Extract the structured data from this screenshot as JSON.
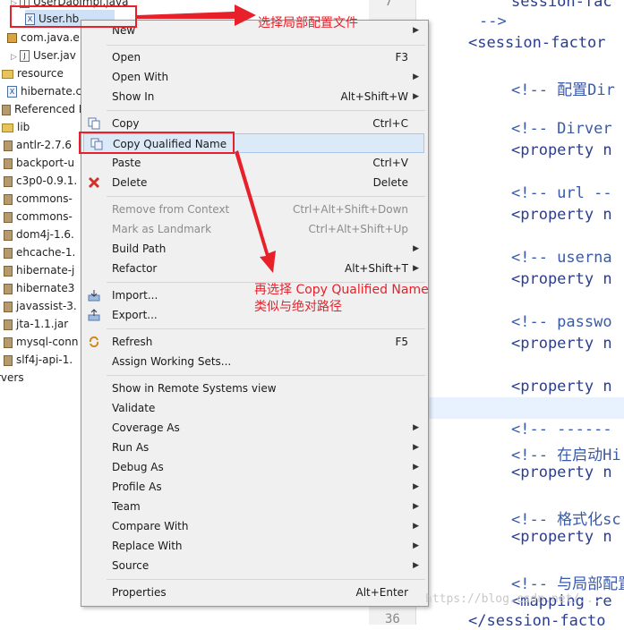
{
  "tree": {
    "items": [
      {
        "label": "UserDaoImpl.java",
        "icon": "java-file-icon"
      },
      {
        "label": "User.hb",
        "icon": "xml-file-icon"
      },
      {
        "label": "com.java.e",
        "icon": "package-icon"
      },
      {
        "label": "User.jav",
        "icon": "java-file-icon"
      },
      {
        "label": "resource",
        "icon": "folder-icon"
      },
      {
        "label": "hibernate.c",
        "icon": "xml-file-icon"
      },
      {
        "label": "Referenced Lil",
        "icon": "library-icon"
      },
      {
        "label": "lib",
        "icon": "folder-icon"
      },
      {
        "label": "antlr-2.7.6",
        "icon": "jar-icon"
      },
      {
        "label": "backport-u",
        "icon": "jar-icon"
      },
      {
        "label": "c3p0-0.9.1.",
        "icon": "jar-icon"
      },
      {
        "label": "commons-",
        "icon": "jar-icon"
      },
      {
        "label": "commons-",
        "icon": "jar-icon"
      },
      {
        "label": "dom4j-1.6.",
        "icon": "jar-icon"
      },
      {
        "label": "ehcache-1.",
        "icon": "jar-icon"
      },
      {
        "label": "hibernate-j",
        "icon": "jar-icon"
      },
      {
        "label": "hibernate3",
        "icon": "jar-icon"
      },
      {
        "label": "javassist-3.",
        "icon": "jar-icon"
      },
      {
        "label": "jta-1.1.jar",
        "icon": "jar-icon"
      },
      {
        "label": "mysql-conn",
        "icon": "jar-icon"
      },
      {
        "label": "slf4j-api-1.",
        "icon": "jar-icon"
      },
      {
        "label": "rvers",
        "icon": "folder-icon"
      }
    ]
  },
  "menu": {
    "items": [
      {
        "label": "New",
        "shortcut": "",
        "submenu": true,
        "disabled": false
      },
      {
        "label": "Open",
        "shortcut": "F3",
        "submenu": false,
        "disabled": false
      },
      {
        "label": "Open With",
        "shortcut": "",
        "submenu": true,
        "disabled": false
      },
      {
        "label": "Show In",
        "shortcut": "Alt+Shift+W",
        "submenu": true,
        "disabled": false
      },
      {
        "label": "Copy",
        "shortcut": "Ctrl+C",
        "submenu": false,
        "disabled": false
      },
      {
        "label": "Copy Qualified Name",
        "shortcut": "",
        "submenu": false,
        "disabled": false,
        "highlighted": true
      },
      {
        "label": "Paste",
        "shortcut": "Ctrl+V",
        "submenu": false,
        "disabled": false
      },
      {
        "label": "Delete",
        "shortcut": "Delete",
        "submenu": false,
        "disabled": false
      },
      {
        "label": "Remove from Context",
        "shortcut": "Ctrl+Alt+Shift+Down",
        "submenu": false,
        "disabled": true
      },
      {
        "label": "Mark as Landmark",
        "shortcut": "Ctrl+Alt+Shift+Up",
        "submenu": false,
        "disabled": true
      },
      {
        "label": "Build Path",
        "shortcut": "",
        "submenu": true,
        "disabled": false
      },
      {
        "label": "Refactor",
        "shortcut": "Alt+Shift+T",
        "submenu": true,
        "disabled": false
      },
      {
        "label": "Import...",
        "shortcut": "",
        "submenu": false,
        "disabled": false
      },
      {
        "label": "Export...",
        "shortcut": "",
        "submenu": false,
        "disabled": false
      },
      {
        "label": "Refresh",
        "shortcut": "F5",
        "submenu": false,
        "disabled": false
      },
      {
        "label": "Assign Working Sets...",
        "shortcut": "",
        "submenu": false,
        "disabled": false
      },
      {
        "label": "Show in Remote Systems view",
        "shortcut": "",
        "submenu": false,
        "disabled": false
      },
      {
        "label": "Validate",
        "shortcut": "",
        "submenu": false,
        "disabled": false
      },
      {
        "label": "Coverage As",
        "shortcut": "",
        "submenu": true,
        "disabled": false
      },
      {
        "label": "Run As",
        "shortcut": "",
        "submenu": true,
        "disabled": false
      },
      {
        "label": "Debug As",
        "shortcut": "",
        "submenu": true,
        "disabled": false
      },
      {
        "label": "Profile As",
        "shortcut": "",
        "submenu": true,
        "disabled": false
      },
      {
        "label": "Team",
        "shortcut": "",
        "submenu": true,
        "disabled": false
      },
      {
        "label": "Compare With",
        "shortcut": "",
        "submenu": true,
        "disabled": false
      },
      {
        "label": "Replace With",
        "shortcut": "",
        "submenu": true,
        "disabled": false
      },
      {
        "label": "Source",
        "shortcut": "",
        "submenu": true,
        "disabled": false
      },
      {
        "label": "Properties",
        "shortcut": "Alt+Enter",
        "submenu": false,
        "disabled": false
      }
    ]
  },
  "editor": {
    "lines": [
      {
        "text": "session-fac",
        "kind": "tag"
      },
      {
        "text": "-->",
        "kind": "cmt"
      },
      {
        "text": "<session-factor",
        "kind": "tag"
      },
      {
        "text": "<!-- 配置Dir",
        "kind": "cmt"
      },
      {
        "text": "<!-- Dirver",
        "kind": "cmt"
      },
      {
        "text": "<property n",
        "kind": "tag"
      },
      {
        "text": "<!-- url --",
        "kind": "cmt"
      },
      {
        "text": "<property n",
        "kind": "tag"
      },
      {
        "text": "<!-- userna",
        "kind": "cmt"
      },
      {
        "text": "<property n",
        "kind": "tag"
      },
      {
        "text": "<!-- passwo",
        "kind": "cmt"
      },
      {
        "text": "<property n",
        "kind": "tag"
      },
      {
        "text": "<property n",
        "kind": "tag"
      },
      {
        "text": "<!-- ------",
        "kind": "cmt"
      },
      {
        "text": "<!-- 在启动Hi",
        "kind": "cmt"
      },
      {
        "text": "<property n",
        "kind": "tag"
      },
      {
        "text": "<!-- 格式化sc",
        "kind": "cmt"
      },
      {
        "text": "<property n",
        "kind": "tag"
      },
      {
        "text": "<!-- 与局部配置",
        "kind": "cmt"
      },
      {
        "text": "<mapping re",
        "kind": "tag"
      },
      {
        "text": "</session-facto",
        "kind": "tag"
      }
    ],
    "line_numbers": [
      "7",
      "36"
    ]
  },
  "annotations": {
    "step1": "选择局部配置文件",
    "step2_line1": "再选择 Copy Qualified Name",
    "step2_line2": "类似与绝对路径",
    "color": "#e8202a"
  },
  "watermark": "https://blog.csdn.net/..."
}
